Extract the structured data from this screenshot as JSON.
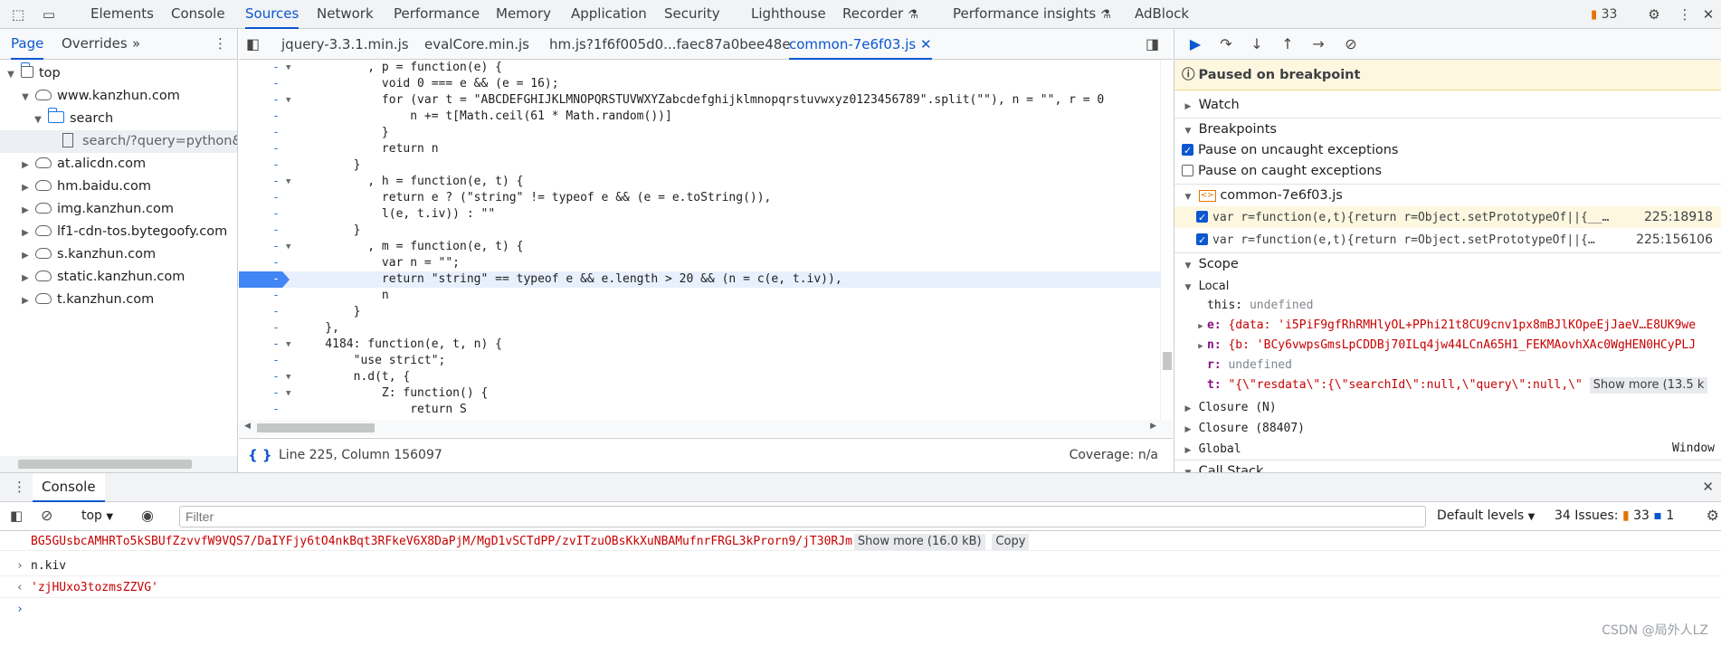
{
  "top_tabs": [
    "Elements",
    "Console",
    "Sources",
    "Network",
    "Performance",
    "Memory",
    "Application",
    "Security",
    "Lighthouse",
    "Recorder",
    "Performance insights",
    "AdBlock"
  ],
  "issues_count": "33",
  "navigator": {
    "tabs": [
      "Page",
      "Overrides"
    ],
    "tree": {
      "top": "top",
      "kanzhun": "www.kanzhun.com",
      "search_folder": "search",
      "search_file": "search/?query=python&t",
      "domains": [
        "at.alicdn.com",
        "hm.baidu.com",
        "img.kanzhun.com",
        "lf1-cdn-tos.bytegoofy.com",
        "s.kanzhun.com",
        "static.kanzhun.com",
        "t.kanzhun.com"
      ]
    }
  },
  "editor": {
    "file_tabs": [
      "jquery-3.3.1.min.js",
      "evalCore.min.js",
      "hm.js?1f6f005d0...faec87a0bee48e",
      "common-7e6f03.js"
    ],
    "code_lines": [
      "          , p = function(e) {",
      "            void 0 === e && (e = 16);",
      "            for (var t = \"ABCDEFGHIJKLMNOPQRSTUVWXYZabcdefghijklmnopqrstuvwxyz0123456789\".split(\"\"), n = \"\", r = 0",
      "                n += t[Math.ceil(61 * Math.random())]",
      "            }",
      "            return n",
      "        }",
      "          , h = function(e, t) {",
      "            return e ? (\"string\" != typeof e && (e = e.toString()),",
      "            l(e, t.iv)) : \"\"",
      "        }",
      "          , m = function(e, t) {",
      "            var n = \"\";",
      "            return \"string\" == typeof e && e.length > 20 && (n = c(e, t.iv)),",
      "            n",
      "        }",
      "    },",
      "    4184: function(e, t, n) {",
      "        \"use strict\";",
      "        n.d(t, {",
      "            Z: function() {",
      "                return S",
      "            }"
    ],
    "status_position": "Line 225, Column 156097",
    "status_coverage": "Coverage: n/a"
  },
  "debugger": {
    "paused_text": "Paused on breakpoint",
    "watch": "Watch",
    "breakpoints_header": "Breakpoints",
    "pause_uncaught": "Pause on uncaught exceptions",
    "pause_caught": "Pause on caught exceptions",
    "bp_file": "common-7e6f03.js",
    "bp1_code": "var r=function(e,t){return r=Object.setPrototypeOf||{__…",
    "bp1_pos": "225:18918",
    "bp2_code": "var r=function(e,t){return r=Object.setPrototypeOf||{…",
    "bp2_pos": "225:156106",
    "scope_header": "Scope",
    "local": "Local",
    "this_val": "undefined",
    "e_val": "{data: 'i5PiF9gfRhRMHlyOL+PPhi21t8CU9cnv1px8mBJlKOpeEjJaeV…E8UK9we",
    "n_val": "{b: 'BCy6vwpsGmsLpCDDBj70ILq4jw44LCnA65H1_FEKMAovhXAc0WgHEN0HCyPLJ",
    "r_val": "undefined",
    "t_val": "\"{\\\"resdata\\\":{\\\"searchId\\\":null,\\\"query\\\":null,\\\"",
    "t_show_more": "Show more (13.5 k",
    "closure1": "Closure (N)",
    "closure2": "Closure (88407)",
    "global": "Global",
    "global_val": "Window",
    "call_stack": "Call Stack"
  },
  "console": {
    "tab": "Console",
    "context": "top",
    "filter_placeholder": "Filter",
    "levels": "Default levels",
    "issues_label": "34 Issues:",
    "issues_warn": "33",
    "issues_info": "1",
    "log_line": "BG5GUsbcAMHRTo5kSBUfZzvvfW9VQS7/DaIYFjy6tO4nkBqt3RFkeV6X8DaPjM/MgD1vSCTdPP/zvITzuOBsKkXuNBAMufnrFRGL3kProrn9/jT30RJm",
    "show_more": "Show more (16.0 kB)",
    "copy": "Copy",
    "input1": "n.kiv",
    "output1": "'zjHUxo3tozmsZZVG'",
    "watermark": "CSDN @局外人LZ"
  }
}
